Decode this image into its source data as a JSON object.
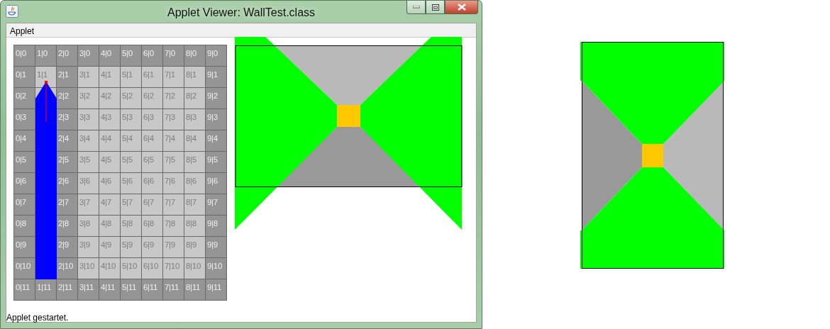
{
  "window": {
    "title": "Applet Viewer: WallTest.class"
  },
  "menu_bar": {
    "items": [
      "Applet"
    ]
  },
  "maze_grid": {
    "rows": [
      [
        {
          "label": "0|0",
          "wall": true
        },
        {
          "label": "1|0",
          "wall": true
        },
        {
          "label": "2|0",
          "wall": true
        },
        {
          "label": "3|0",
          "wall": true
        },
        {
          "label": "4|0",
          "wall": true
        },
        {
          "label": "5|0",
          "wall": true
        },
        {
          "label": "6|0",
          "wall": true
        },
        {
          "label": "7|0",
          "wall": true
        },
        {
          "label": "8|0",
          "wall": true
        },
        {
          "label": "9|0",
          "wall": true
        }
      ],
      [
        {
          "label": "0|1",
          "wall": true
        },
        {
          "label": "1|1",
          "wall": false
        },
        {
          "label": "2|1",
          "wall": true
        },
        {
          "label": "3|1",
          "wall": false
        },
        {
          "label": "4|1",
          "wall": false
        },
        {
          "label": "5|1",
          "wall": false
        },
        {
          "label": "6|1",
          "wall": false
        },
        {
          "label": "7|1",
          "wall": false
        },
        {
          "label": "8|1",
          "wall": false
        },
        {
          "label": "9|1",
          "wall": true
        }
      ],
      [
        {
          "label": "0|2",
          "wall": true
        },
        {},
        {
          "label": "2|2",
          "wall": true
        },
        {
          "label": "3|2",
          "wall": false
        },
        {
          "label": "4|2",
          "wall": false
        },
        {
          "label": "5|2",
          "wall": false
        },
        {
          "label": "6|2",
          "wall": false
        },
        {
          "label": "7|2",
          "wall": false
        },
        {
          "label": "8|2",
          "wall": false
        },
        {
          "label": "9|2",
          "wall": true
        }
      ],
      [
        {
          "label": "0|3",
          "wall": true
        },
        {},
        {
          "label": "2|3",
          "wall": true
        },
        {
          "label": "3|3",
          "wall": false
        },
        {
          "label": "4|3",
          "wall": false
        },
        {
          "label": "5|3",
          "wall": false
        },
        {
          "label": "6|3",
          "wall": false
        },
        {
          "label": "7|3",
          "wall": false
        },
        {
          "label": "8|3",
          "wall": false
        },
        {
          "label": "9|3",
          "wall": true
        }
      ],
      [
        {
          "label": "0|4",
          "wall": true
        },
        {},
        {
          "label": "2|4",
          "wall": true
        },
        {
          "label": "3|4",
          "wall": false
        },
        {
          "label": "4|4",
          "wall": false
        },
        {
          "label": "5|4",
          "wall": false
        },
        {
          "label": "6|4",
          "wall": false
        },
        {
          "label": "7|4",
          "wall": false
        },
        {
          "label": "8|4",
          "wall": false
        },
        {
          "label": "9|4",
          "wall": true
        }
      ],
      [
        {
          "label": "0|5",
          "wall": true
        },
        {},
        {
          "label": "2|5",
          "wall": true
        },
        {
          "label": "3|5",
          "wall": false
        },
        {
          "label": "4|5",
          "wall": false
        },
        {
          "label": "5|5",
          "wall": false
        },
        {
          "label": "6|5",
          "wall": false
        },
        {
          "label": "7|5",
          "wall": false
        },
        {
          "label": "8|5",
          "wall": false
        },
        {
          "label": "9|5",
          "wall": true
        }
      ],
      [
        {
          "label": "0|6",
          "wall": true
        },
        {},
        {
          "label": "2|6",
          "wall": true
        },
        {
          "label": "3|6",
          "wall": false
        },
        {
          "label": "4|6",
          "wall": false
        },
        {
          "label": "5|6",
          "wall": false
        },
        {
          "label": "6|6",
          "wall": false
        },
        {
          "label": "7|6",
          "wall": false
        },
        {
          "label": "8|6",
          "wall": false
        },
        {
          "label": "9|6",
          "wall": true
        }
      ],
      [
        {
          "label": "0|7",
          "wall": true
        },
        {},
        {
          "label": "2|7",
          "wall": true
        },
        {
          "label": "3|7",
          "wall": false
        },
        {
          "label": "4|7",
          "wall": false
        },
        {
          "label": "5|7",
          "wall": false
        },
        {
          "label": "6|7",
          "wall": false
        },
        {
          "label": "7|7",
          "wall": false
        },
        {
          "label": "8|7",
          "wall": false
        },
        {
          "label": "9|7",
          "wall": true
        }
      ],
      [
        {
          "label": "0|8",
          "wall": true
        },
        {},
        {
          "label": "2|8",
          "wall": true
        },
        {
          "label": "3|8",
          "wall": false
        },
        {
          "label": "4|8",
          "wall": false
        },
        {
          "label": "5|8",
          "wall": false
        },
        {
          "label": "6|8",
          "wall": false
        },
        {
          "label": "7|8",
          "wall": false
        },
        {
          "label": "8|8",
          "wall": false
        },
        {
          "label": "9|8",
          "wall": true
        }
      ],
      [
        {
          "label": "0|9",
          "wall": true
        },
        {},
        {
          "label": "2|9",
          "wall": true
        },
        {
          "label": "3|9",
          "wall": false
        },
        {
          "label": "4|9",
          "wall": false
        },
        {
          "label": "5|9",
          "wall": false
        },
        {
          "label": "6|9",
          "wall": false
        },
        {
          "label": "7|9",
          "wall": false
        },
        {
          "label": "8|9",
          "wall": false
        },
        {
          "label": "9|9",
          "wall": true
        }
      ],
      [
        {
          "label": "0|10",
          "wall": true
        },
        {},
        {
          "label": "2|10",
          "wall": true
        },
        {
          "label": "3|10",
          "wall": false
        },
        {
          "label": "4|10",
          "wall": false
        },
        {
          "label": "5|10",
          "wall": false
        },
        {
          "label": "6|10",
          "wall": false
        },
        {
          "label": "7|10",
          "wall": false
        },
        {
          "label": "8|10",
          "wall": false
        },
        {
          "label": "9|10",
          "wall": true
        }
      ],
      [
        {
          "label": "0|11",
          "wall": true
        },
        {
          "label": "1|11",
          "wall": true
        },
        {
          "label": "2|11",
          "wall": true
        },
        {
          "label": "3|11",
          "wall": true
        },
        {
          "label": "4|11",
          "wall": true
        },
        {
          "label": "5|11",
          "wall": true
        },
        {
          "label": "6|11",
          "wall": true
        },
        {
          "label": "7|11",
          "wall": true
        },
        {
          "label": "8|11",
          "wall": true
        },
        {
          "label": "9|11",
          "wall": true
        }
      ]
    ]
  },
  "status_bar": {
    "text": "Applet gestartet."
  }
}
